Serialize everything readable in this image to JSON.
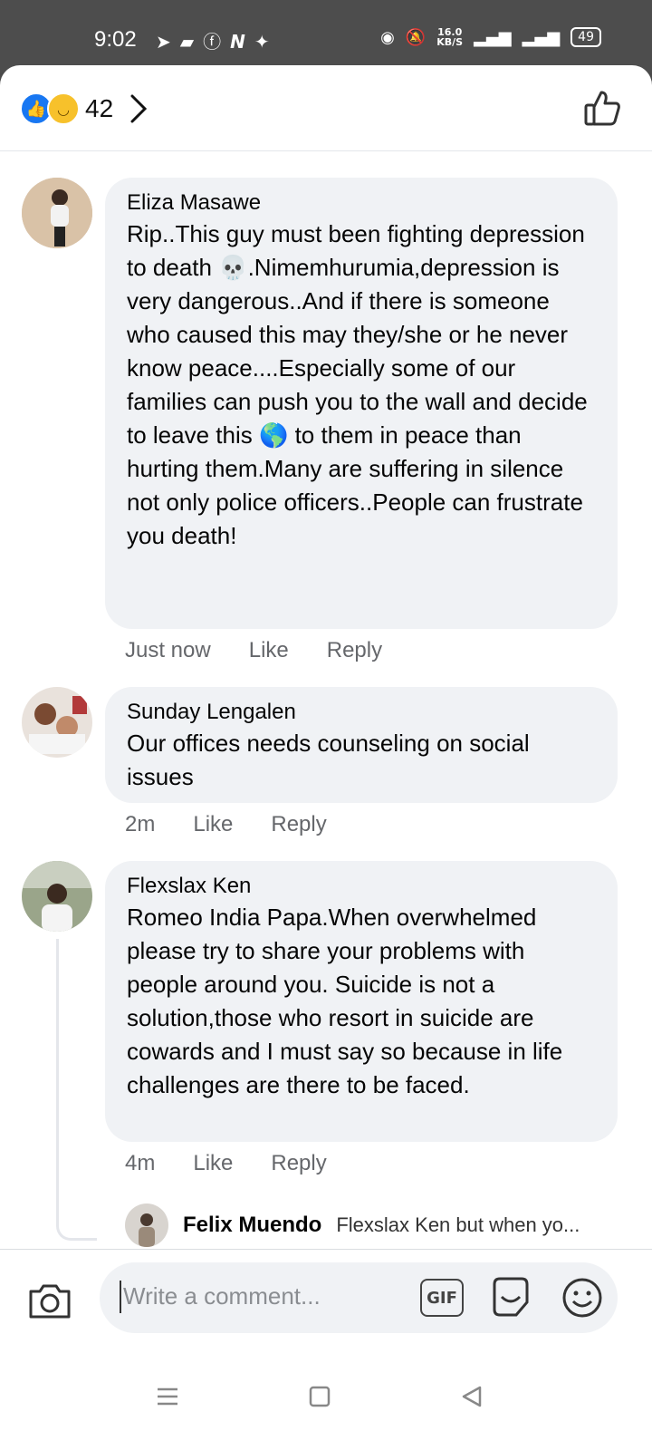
{
  "status_bar": {
    "time": "9:02",
    "notif_icons": [
      "telegram-icon",
      "message-icon",
      "facebook-icon",
      "netflix-icon",
      "twitter-icon"
    ],
    "speed_value": "16.0",
    "speed_unit": "KB/S",
    "battery": "49"
  },
  "reactions": {
    "count": "42",
    "types": [
      "like",
      "sad"
    ]
  },
  "comments": [
    {
      "name": "Eliza Masawe",
      "text": "Rip..This guy must been fighting depression to death 💀.Nimemhurumia,depression is very dangerous..And if there is someone who caused this may they/she or he never know peace....Especially some of our families can push you to the wall and decide to leave this 🌎 to them in peace than hurting them.Many are suffering in silence not only police officers..People can frustrate you death!",
      "time": "Just now",
      "like": "Like",
      "reply": "Reply"
    },
    {
      "name": "Sunday Lengalen",
      "text": "Our offices needs counseling on social issues",
      "time": "2m",
      "like": "Like",
      "reply": "Reply"
    },
    {
      "name": "Flexslax Ken",
      "text": "Romeo India Papa.When overwhelmed please try to share your problems with people around you. Suicide is not a solution,those who resort in suicide are cowards and I must say so because in life challenges are there to be faced.",
      "time": "4m",
      "like": "Like",
      "reply": "Reply"
    }
  ],
  "reply_preview": {
    "name": "Felix Muendo",
    "text": "Flexslax Ken but when yo..."
  },
  "composer": {
    "placeholder": "Write a comment...",
    "gif_label": "GIF"
  }
}
